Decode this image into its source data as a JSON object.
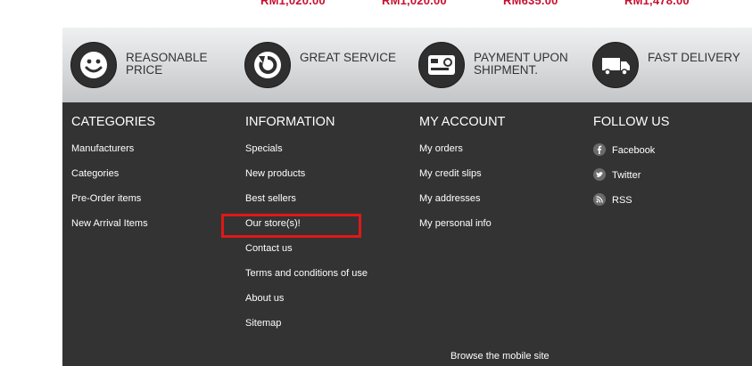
{
  "prices": [
    "RM1,020.00",
    "RM1,020.00",
    "RM635.00",
    "RM1,478.00"
  ],
  "features": [
    {
      "icon": "smiley-icon",
      "text": "REASONABLE PRICE"
    },
    {
      "icon": "refresh-arrow-icon",
      "text": "GREAT SERVICE"
    },
    {
      "icon": "credit-card-icon",
      "text": "PAYMENT UPON SHIPMENT."
    },
    {
      "icon": "delivery-truck-icon",
      "text": "FAST DELIVERY"
    }
  ],
  "footer": {
    "categories": {
      "title": "CATEGORIES",
      "items": [
        "Manufacturers",
        "Categories",
        "Pre-Order items",
        "New Arrival Items"
      ]
    },
    "information": {
      "title": "INFORMATION",
      "items": [
        "Specials",
        "New products",
        "Best sellers",
        "Our store(s)!",
        "Contact us",
        "Terms and conditions of use",
        "About us",
        "Sitemap"
      ]
    },
    "account": {
      "title": "MY ACCOUNT",
      "items": [
        "My orders",
        "My credit slips",
        "My addresses",
        "My personal info"
      ]
    },
    "follow": {
      "title": "FOLLOW US",
      "items": [
        {
          "icon": "facebook-icon",
          "label": "Facebook"
        },
        {
          "icon": "twitter-icon",
          "label": "Twitter"
        },
        {
          "icon": "rss-icon",
          "label": "RSS"
        }
      ]
    },
    "mobile_link": "Browse the mobile site"
  },
  "colors": {
    "price": "#c8102e",
    "footer_bg": "#333333",
    "highlight": "#e01818"
  }
}
